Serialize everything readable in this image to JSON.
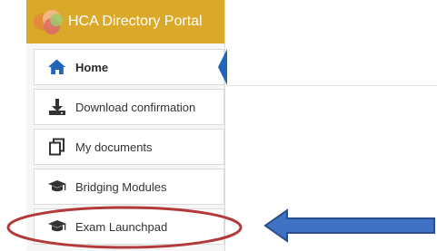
{
  "header": {
    "title": "HCA Directory Portal"
  },
  "nav": {
    "items": [
      {
        "label": "Home",
        "icon": "home-icon"
      },
      {
        "label": "Download confirmation",
        "icon": "download-icon"
      },
      {
        "label": "My documents",
        "icon": "documents-icon"
      },
      {
        "label": "Bridging Modules",
        "icon": "graduation-cap-icon"
      },
      {
        "label": "Exam Launchpad",
        "icon": "graduation-cap-icon"
      }
    ]
  },
  "colors": {
    "header_bg": "#dba92a",
    "active_accent": "#1f66b8",
    "annotation_ellipse": "#b23a3a",
    "annotation_arrow": "#3a67b3"
  }
}
